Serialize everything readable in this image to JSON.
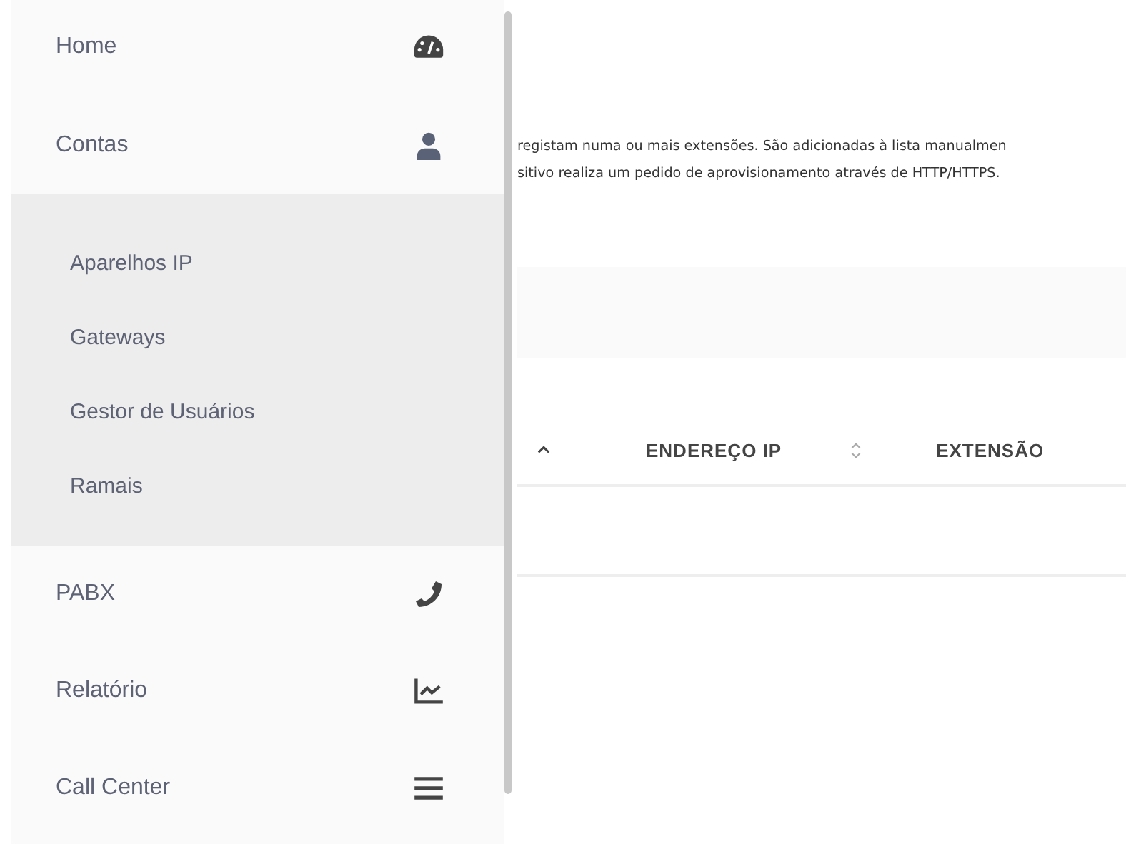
{
  "sidebar": {
    "items": [
      {
        "label": "Home",
        "kind": "gauge"
      },
      {
        "label": "Contas",
        "kind": "user",
        "expanded": true,
        "children": [
          {
            "label": "Aparelhos IP"
          },
          {
            "label": "Gateways"
          },
          {
            "label": "Gestor de Usuários"
          },
          {
            "label": "Ramais"
          }
        ]
      },
      {
        "label": "PABX",
        "kind": "phone"
      },
      {
        "label": "Relatório",
        "kind": "chart"
      },
      {
        "label": "Call Center",
        "kind": "bars"
      }
    ]
  },
  "description": [
    "registam numa ou mais extensões. São adicionadas à lista manualmen",
    "sitivo realiza um pedido de aprovisionamento através de HTTP/HTTPS."
  ],
  "table": {
    "columns": [
      {
        "label": "ENDEREÇO IP"
      },
      {
        "label": "EXTENSÃO"
      }
    ]
  }
}
